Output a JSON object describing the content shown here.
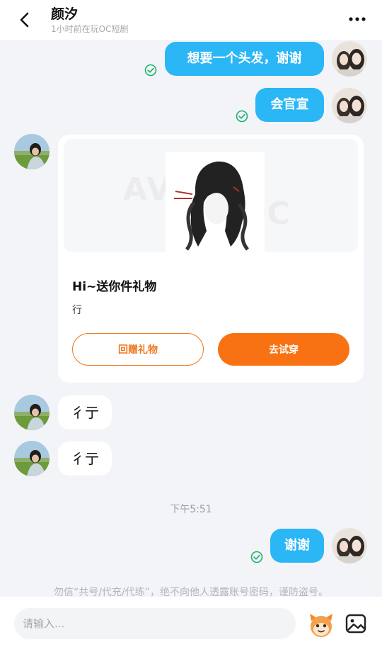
{
  "header": {
    "title": "颜汐",
    "status": "1小时前在玩OC短剧",
    "back_icon": "chevron-left-icon",
    "more_icon": "more-dots-icon"
  },
  "messages": {
    "m1": "想要一个头发，谢谢",
    "m2": "会官宣",
    "m3": "彳亍",
    "m4": "彳亍",
    "m5": "谢谢"
  },
  "gift_card": {
    "title": "Hi~送你件礼物",
    "text": "行",
    "return_gift_label": "回赠礼物",
    "try_on_label": "去试穿",
    "accent_color": "#f87214"
  },
  "timestamp": "下午5:51",
  "notice": "勿信“共号/代充/代练”，绝不向他人透露账号密码，谨防盗号。",
  "composer": {
    "placeholder": "请输入...",
    "emoji_icon": "mascot-emoji-icon",
    "image_icon": "image-icon"
  },
  "colors": {
    "my_bubble": "#2bb6f6",
    "sent_check": "#18b46b"
  }
}
